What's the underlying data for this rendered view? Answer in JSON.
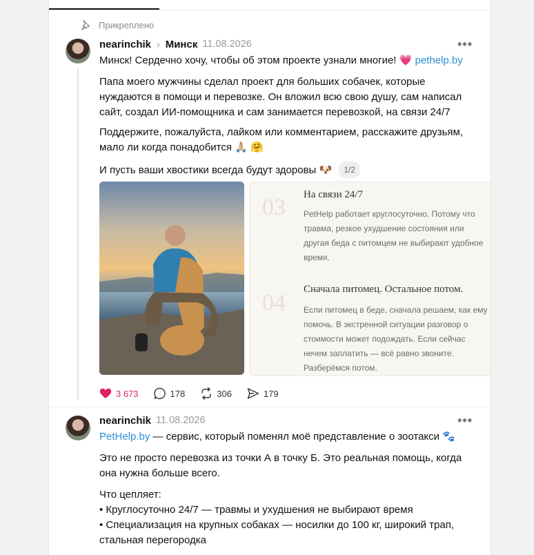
{
  "pinned_label": "Прикреплено",
  "post1": {
    "username": "nearinchik",
    "topic": "Минск",
    "date": "11.08.2026",
    "more": "•••",
    "line1": "Минск! Сердечно хочу, чтобы об этом проекте узнали многие!",
    "line1_emoji": "💗",
    "line1_link": "pethelp.by",
    "para2": "Папа моего мужчины сделал проект для больших собачек, которые нуждаются в помощи и перевозке. Он вложил всю свою душу, сам написал сайт, создал ИИ-помощника и сам занимается перевозкой, на связи 24/7",
    "para3": "Поддержите, пожалуйста, лайком или комментарием, расскажите друзьям, мало ли когда понадобится 🙏🏼 🤗",
    "para4": "И пусть ваши хвостики всегда будут здоровы 🐶",
    "media_counter": "1/2",
    "slide": {
      "num1": "03",
      "heading1": "На связи 24/7",
      "text1": "PetHelp работает круглосуточно. Потому что травма, резкое ухудшение состояния или другая беда с питомцем не выбирают удобное время.",
      "num2": "04",
      "heading2": "Сначала питомец. Остальное потом.",
      "text2": "Если питомец в беде, сначала решаем, как ему помочь. В экстренной ситуации разговор о стоимости может подождать. Если сейчас нечем заплатить — всё равно звоните. Разберёмся потом."
    },
    "likes": "3 673",
    "comments": "178",
    "reposts": "306",
    "shares": "179"
  },
  "post2": {
    "username": "nearinchik",
    "date": "11.08.2026",
    "more": "•••",
    "link": "PetHelp.by",
    "line1_rest": "— сервис, который поменял моё представление о зоотакси 🐾",
    "para2": "Это не просто перевозка из точки А в точку Б. Это реальная помощь, когда она нужна больше всего.",
    "list_title": "Что цепляет:",
    "bullet1": "• Круглосуточно 24/7 — травмы и ухудшения не выбирают время",
    "bullet2": "• Специализация на крупных собаках — носилки до 100 кг, широкий трап, стальная перегородка"
  },
  "colors": {
    "like": "#e0245e",
    "link": "#2a8fd6"
  }
}
